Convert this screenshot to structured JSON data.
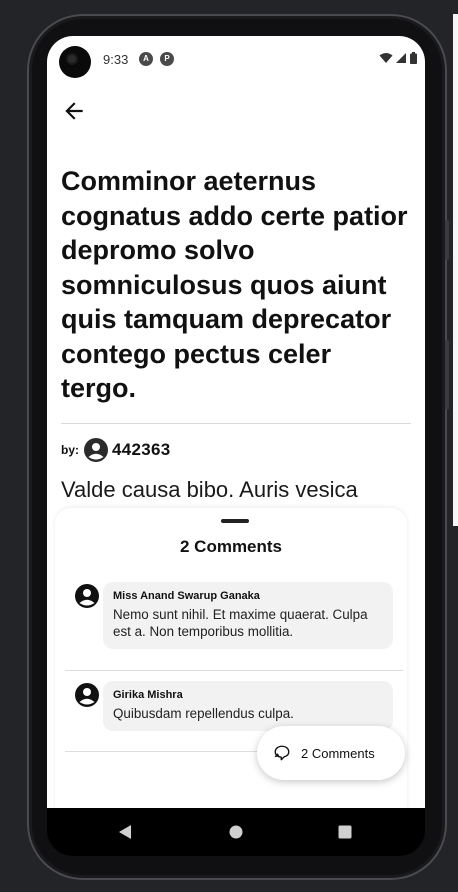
{
  "status_bar": {
    "time": "9:33",
    "icons": [
      "camera-icon",
      "app-a-icon",
      "app-p-icon",
      "wifi-icon",
      "signal-icon",
      "battery-icon"
    ]
  },
  "toolbar": {
    "back_icon": "arrow-left-icon"
  },
  "post": {
    "title": "Comminor aeternus cognatus addo certe patior depromo solvo somniculosus quos aiunt quis tamquam deprecator contego pectus celer tergo.",
    "by_label": "by:",
    "author": "442363",
    "body_preview": "Valde causa bibo. Auris vesica"
  },
  "comments_sheet": {
    "title": "2 Comments",
    "comments": [
      {
        "author": "Miss Anand Swarup Ganaka",
        "text": "Nemo sunt nihil. Et maxime quaerat. Culpa est a. Non temporibus mollitia."
      },
      {
        "author": "Girika Mishra",
        "text": "Quibusdam repellendus culpa."
      }
    ]
  },
  "fab": {
    "label": "2 Comments",
    "icon": "chat-bubble-icon"
  },
  "nav_bar": {
    "icons": [
      "back-triangle-icon",
      "home-circle-icon",
      "recents-square-icon"
    ]
  },
  "colors": {
    "screen_bg": "#ffffff",
    "text": "#111111",
    "comment_bubble": "#f2f2f2",
    "device_bg": "#232428"
  }
}
